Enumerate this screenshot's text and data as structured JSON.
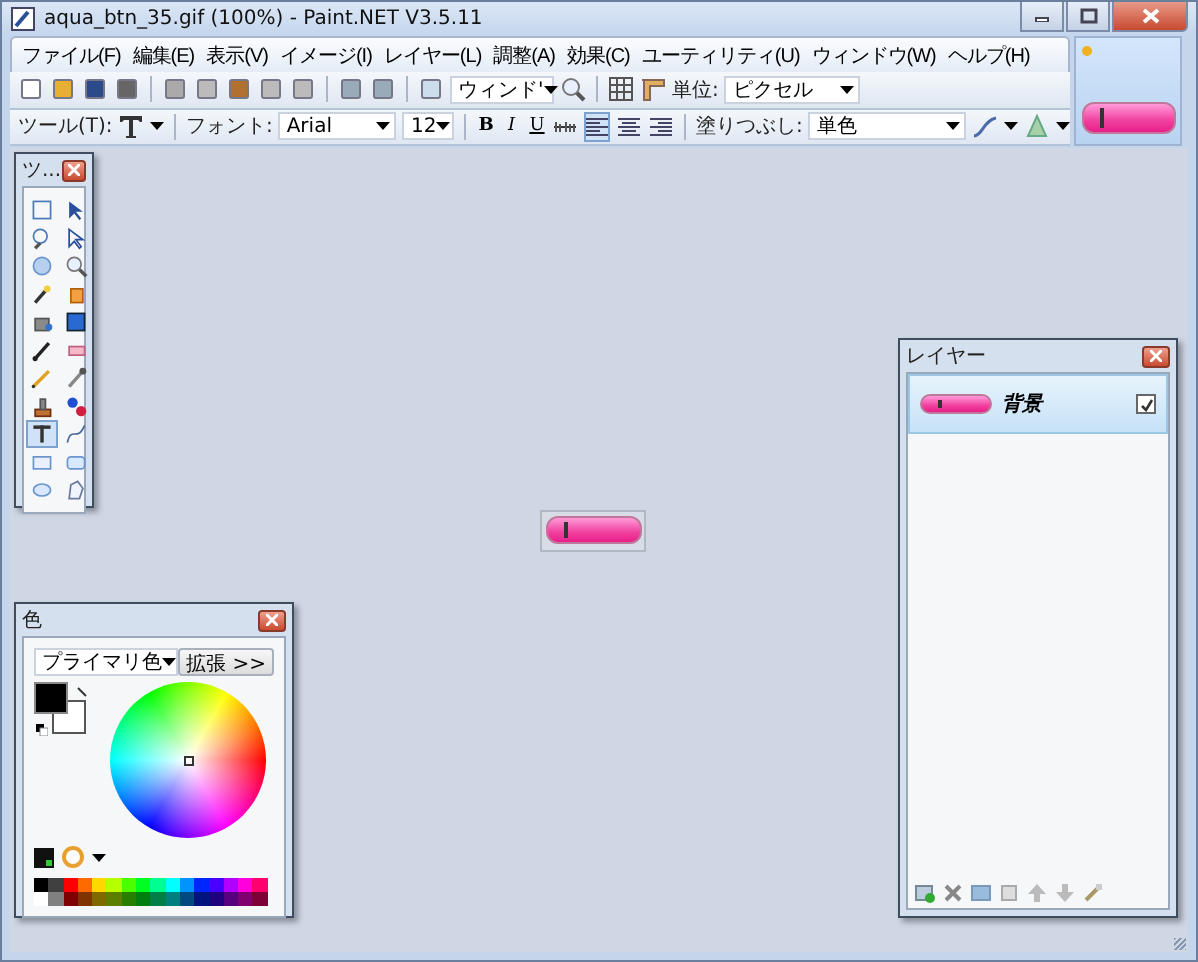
{
  "window": {
    "title": "aqua_btn_35.gif (100%) - Paint.NET V3.5.11"
  },
  "menu": [
    {
      "label": "ファイル(F)"
    },
    {
      "label": "編集(E)"
    },
    {
      "label": "表示(V)"
    },
    {
      "label": "イメージ(I)"
    },
    {
      "label": "レイヤー(L)"
    },
    {
      "label": "調整(A)"
    },
    {
      "label": "効果(C)"
    },
    {
      "label": "ユーティリティ(U)"
    },
    {
      "label": "ウィンドウ(W)"
    },
    {
      "label": "ヘルプ(H)"
    }
  ],
  "toolbar": {
    "zoom": "ウィンド'",
    "units_label": "単位:",
    "units": "ピクセル"
  },
  "text_toolbar": {
    "tool_label": "ツール(T):",
    "font_label": "フォント:",
    "font": "Arial",
    "size": "12",
    "bold": "B",
    "italic": "I",
    "underline": "U",
    "align": [
      {
        "selected": true
      },
      {
        "selected": false
      },
      {
        "selected": false
      }
    ],
    "fill_label": "塗りつぶし:",
    "fill": "単色"
  },
  "images": [
    {
      "selected": true
    }
  ],
  "tools_window": {
    "title": "ツ...",
    "tools": [
      {
        "selected": false
      },
      {
        "selected": false
      },
      {
        "selected": false
      },
      {
        "selected": false
      },
      {
        "selected": false
      },
      {
        "selected": false
      },
      {
        "selected": false
      },
      {
        "selected": false
      },
      {
        "selected": false
      },
      {
        "selected": false
      },
      {
        "selected": false
      },
      {
        "selected": false
      },
      {
        "selected": false
      },
      {
        "selected": false
      },
      {
        "selected": false
      },
      {
        "selected": false
      },
      {
        "selected": true
      },
      {
        "selected": false
      },
      {
        "selected": false
      },
      {
        "selected": false
      },
      {
        "selected": false
      },
      {
        "selected": false
      }
    ]
  },
  "colors_window": {
    "title": "色",
    "mode": "プライマリ色",
    "more_button": "拡張 >>",
    "palette": [
      {
        "color": "#000000"
      },
      {
        "color": "#404040"
      },
      {
        "color": "#ff0000"
      },
      {
        "color": "#ff6a00"
      },
      {
        "color": "#ffd800"
      },
      {
        "color": "#b6ff00"
      },
      {
        "color": "#4cff00"
      },
      {
        "color": "#00ff21"
      },
      {
        "color": "#00ff90"
      },
      {
        "color": "#00ffff"
      },
      {
        "color": "#0094ff"
      },
      {
        "color": "#0026ff"
      },
      {
        "color": "#4800ff"
      },
      {
        "color": "#b200ff"
      },
      {
        "color": "#ff00dc"
      },
      {
        "color": "#ff006e"
      },
      {
        "color": "#ffffff"
      },
      {
        "color": "#808080"
      },
      {
        "color": "#7f0000"
      },
      {
        "color": "#7f3300"
      },
      {
        "color": "#7f6a00"
      },
      {
        "color": "#5b7f00"
      },
      {
        "color": "#267f00"
      },
      {
        "color": "#007f0e"
      },
      {
        "color": "#007f46"
      },
      {
        "color": "#007f7f"
      },
      {
        "color": "#004a7f"
      },
      {
        "color": "#00137f"
      },
      {
        "color": "#21007f"
      },
      {
        "color": "#57007f"
      },
      {
        "color": "#7f006e"
      },
      {
        "color": "#7f0037"
      }
    ]
  },
  "layers_window": {
    "title": "レイヤー",
    "layers": [
      {
        "name": "背景",
        "visible": true,
        "selected": true
      }
    ]
  }
}
